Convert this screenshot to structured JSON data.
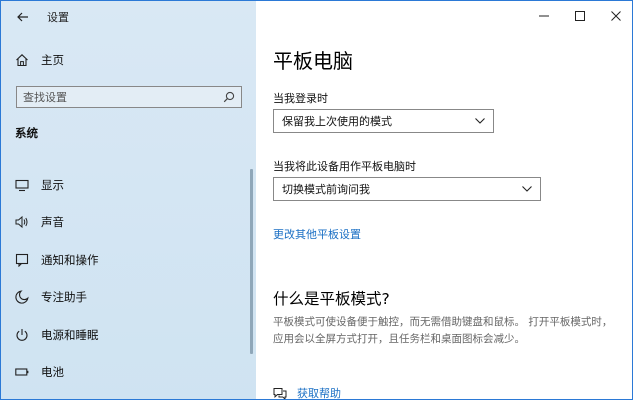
{
  "app": {
    "title": "设置"
  },
  "sidebar": {
    "home_label": "主页",
    "search_placeholder": "查找设置",
    "section": "系统",
    "items": [
      {
        "label": "显示",
        "icon": "display-icon"
      },
      {
        "label": "声音",
        "icon": "sound-icon"
      },
      {
        "label": "通知和操作",
        "icon": "notification-icon"
      },
      {
        "label": "专注助手",
        "icon": "moon-icon"
      },
      {
        "label": "电源和睡眠",
        "icon": "power-icon"
      },
      {
        "label": "电池",
        "icon": "battery-icon"
      }
    ]
  },
  "main": {
    "title": "平板电脑",
    "signin_label": "当我登录时",
    "signin_value": "保留我上次使用的模式",
    "mode_label": "当我将此设备用作平板电脑时",
    "mode_value": "切换模式前询问我",
    "more_link": "更改其他平板设置",
    "what_title": "什么是平板模式?",
    "what_desc": "平板模式可使设备便于触控，而无需借助键盘和鼠标。 打开平板模式时，应用会以全屏方式打开，且任务栏和桌面图标会减少。",
    "help_label": "获取帮助"
  },
  "colors": {
    "accent": "#1a6fc4",
    "sidebar_bg": "#d7e7f3",
    "border": "#2b79d6"
  }
}
